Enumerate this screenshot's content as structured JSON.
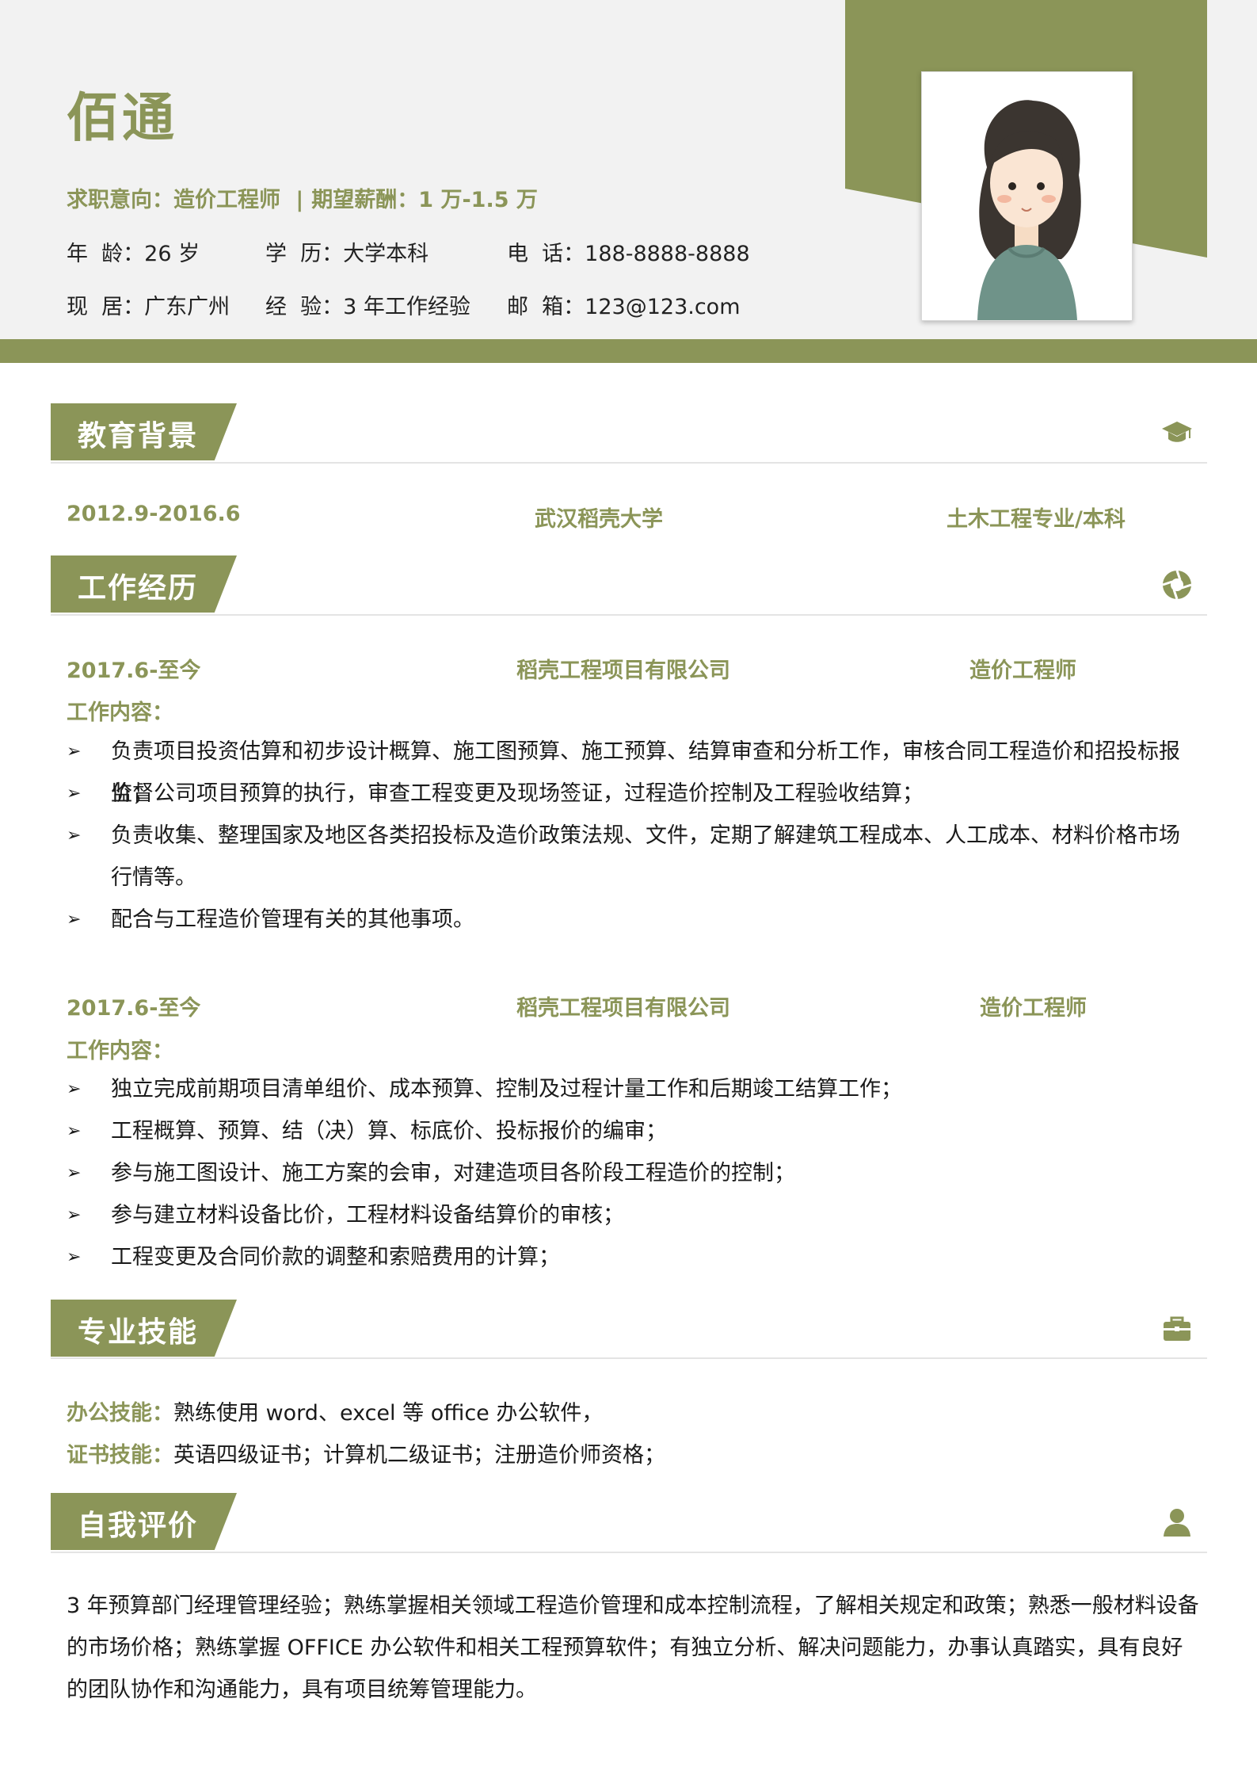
{
  "colors": {
    "accent": "#8b9558",
    "header_bg": "#f2f2f2"
  },
  "header": {
    "name": "佰通",
    "intent_label": "求职意向：",
    "intent_value": "造价工程师",
    "divider": "|",
    "salary_label": "期望薪酬：",
    "salary_value": "1 万-1.5 万",
    "info": [
      {
        "label": "年  龄：",
        "value": "26 岁"
      },
      {
        "label": "学  历：",
        "value": "大学本科"
      },
      {
        "label": "电  话：",
        "value": "188-8888-8888"
      },
      {
        "label": "现  居：",
        "value": "广东广州"
      },
      {
        "label": "经  验：",
        "value": "3 年工作经验"
      },
      {
        "label": "邮  箱：",
        "value": "123@123.com"
      }
    ]
  },
  "sections": {
    "education": {
      "title": "教育背景",
      "icon": "graduation-cap-icon"
    },
    "work": {
      "title": "工作经历",
      "icon": "aperture-icon"
    },
    "skills": {
      "title": "专业技能",
      "icon": "briefcase-icon"
    },
    "self": {
      "title": "自我评价",
      "icon": "user-icon"
    }
  },
  "education": {
    "date": "2012.9-2016.6",
    "school": "武汉稻壳大学",
    "major": "土木工程专业/本科"
  },
  "work": [
    {
      "date": "2017.6-至今",
      "company": "稻壳工程项目有限公司",
      "role": "造价工程师",
      "content_label": "工作内容：",
      "items": [
        "负责项目投资估算和初步设计概算、施工图预算、施工预算、结算审查和分析工作，审核合同工程造价和招投标报价；",
        "监督公司项目预算的执行，审查工程变更及现场签证，过程造价控制及工程验收结算；",
        "负责收集、整理国家及地区各类招投标及造价政策法规、文件，定期了解建筑工程成本、人工成本、材料价格市场行情等。",
        "配合与工程造价管理有关的其他事项。"
      ]
    },
    {
      "date": "2017.6-至今",
      "company": "稻壳工程项目有限公司",
      "role": "造价工程师",
      "content_label": "工作内容：",
      "items": [
        "独立完成前期项目清单组价、成本预算、控制及过程计量工作和后期竣工结算工作；",
        "工程概算、预算、结（决）算、标底价、投标报价的编审；",
        "参与施工图设计、施工方案的会审，对建造项目各阶段工程造价的控制；",
        "参与建立材料设备比价，工程材料设备结算价的审核；",
        "工程变更及合同价款的调整和索赔费用的计算；"
      ]
    }
  ],
  "bullet_glyph": "➢",
  "skills": [
    {
      "label": "办公技能：",
      "value": "熟练使用 word、excel 等 office 办公软件，"
    },
    {
      "label": "证书技能：",
      "value": "英语四级证书；计算机二级证书；注册造价师资格；"
    }
  ],
  "self_eval": "3 年预算部门经理管理经验；熟练掌握相关领域工程造价管理和成本控制流程，了解相关规定和政策；熟悉一般材料设备的市场价格；熟练掌握 OFFICE 办公软件和相关工程预算软件；有独立分析、解决问题能力，办事认真踏实，具有良好的团队协作和沟通能力，具有项目统筹管理能力。"
}
